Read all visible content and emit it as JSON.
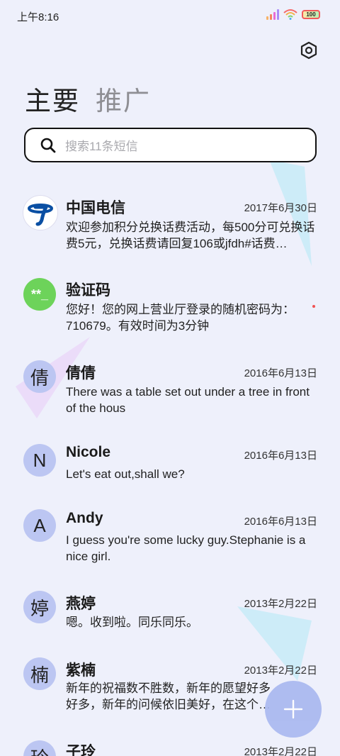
{
  "status": {
    "time": "上午8:16",
    "battery": "100"
  },
  "tabs": [
    {
      "label": "主要",
      "active": true
    },
    {
      "label": "推广",
      "active": false
    }
  ],
  "search": {
    "placeholder": "搜索11条短信"
  },
  "messages": [
    {
      "sender": "中国电信",
      "date": "2017年6月30日",
      "preview": "欢迎参加积分兑换话费活动，每500分可兑换话费5元，兑换话费请回复106或jfdh#话费…",
      "avatar_icon": "china-telecom-logo-icon"
    },
    {
      "sender": "验证码",
      "date": "",
      "preview": "您好！您的网上营业厅登录的随机密码为：710679。有效时间为3分钟",
      "avatar_text": "**_"
    },
    {
      "sender": "倩倩",
      "date": "2016年6月13日",
      "preview": "There was a table set out under a tree in front of the hous",
      "avatar_text": "倩"
    },
    {
      "sender": "Nicole",
      "date": "2016年6月13日",
      "preview": "Let's eat out,shall we?",
      "avatar_text": "N"
    },
    {
      "sender": "Andy",
      "date": "2016年6月13日",
      "preview": "I guess you're some lucky guy.Stephanie is a nice girl.",
      "avatar_text": "A"
    },
    {
      "sender": "燕婷",
      "date": "2013年2月22日",
      "preview": "嗯。收到啦。同乐同乐。",
      "avatar_text": "婷"
    },
    {
      "sender": "紫楠",
      "date": "2013年2月22日",
      "preview": "新年的祝福数不胜数，新年的愿望好多好多，新年的问候依旧美好，在这个温馨的",
      "avatar_text": "楠"
    },
    {
      "sender": "子玲",
      "date": "2013年2月22日",
      "preview": "",
      "avatar_text": "玲"
    }
  ],
  "colors": {
    "background": "#eef0fb",
    "avatar": "#bcc6f2",
    "verification_avatar": "#6dd35a",
    "telecom_blue": "#0a4fa3",
    "fab": "#a9b8f0"
  },
  "icons": {
    "settings": "settings-hexagon-icon",
    "search": "search-icon",
    "compose": "plus-icon"
  }
}
